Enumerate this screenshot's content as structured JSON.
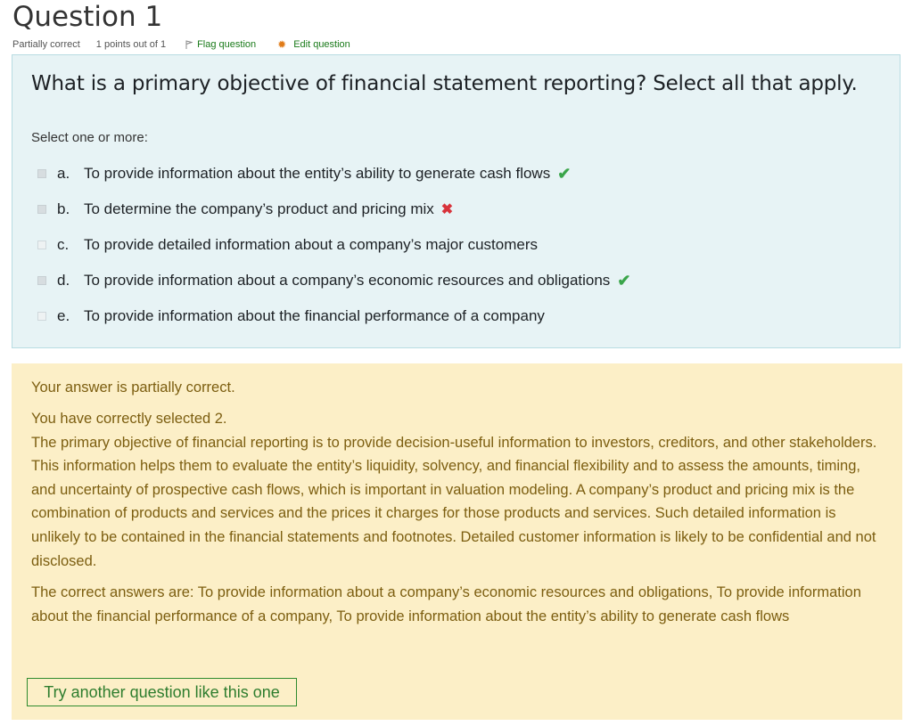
{
  "question": {
    "title": "Question 1",
    "state": "Partially correct",
    "grade": "1 points out of 1",
    "flag_label": "Flag question",
    "edit_label": "Edit question"
  },
  "formulation": {
    "text": "What is a primary objective of financial statement reporting? Select all that apply.",
    "prompt": "Select one or more:",
    "options": [
      {
        "letter": "a.",
        "text": "To provide information about the entity’s ability to generate cash flows",
        "checked": true,
        "mark": "correct"
      },
      {
        "letter": "b.",
        "text": "To determine the company’s product and pricing mix",
        "checked": true,
        "mark": "incorrect"
      },
      {
        "letter": "c.",
        "text": "To provide detailed information about a company’s major customers",
        "checked": false,
        "mark": ""
      },
      {
        "letter": "d.",
        "text": "To provide information about a company’s economic resources and obligations",
        "checked": true,
        "mark": "correct"
      },
      {
        "letter": "e.",
        "text": "To provide information about the financial performance of a company",
        "checked": false,
        "mark": ""
      }
    ]
  },
  "feedback": {
    "summary": "Your answer is partially correct.",
    "correct_count": "You have correctly selected 2.",
    "general": "The primary objective of financial reporting is to provide decision-useful information to investors, creditors, and other stakeholders. This information helps them to evaluate the entity’s liquidity, solvency, and financial flexibility and to assess the amounts, timing, and uncertainty of prospective cash flows, which is important in valuation modeling. A company’s product and pricing mix is the combination of products and services and the prices it charges for those products and services. Such detailed information is unlikely to be contained in the financial statements and footnotes. Detailed customer information is likely to be confidential and not disclosed.",
    "right_answer": "The correct answers are: To provide information about a company’s economic resources and obligations, To provide information about the financial performance of a company, To provide information about the entity’s ability to generate cash flows",
    "try_again_label": "Try another question like this one"
  },
  "colors": {
    "formulation_bg": "#e7f3f5",
    "feedback_bg": "#fcefc7",
    "feedback_text": "#7c5e10",
    "correct": "#3aa54a",
    "incorrect": "#d8333b",
    "link": "#1a7a1a"
  }
}
